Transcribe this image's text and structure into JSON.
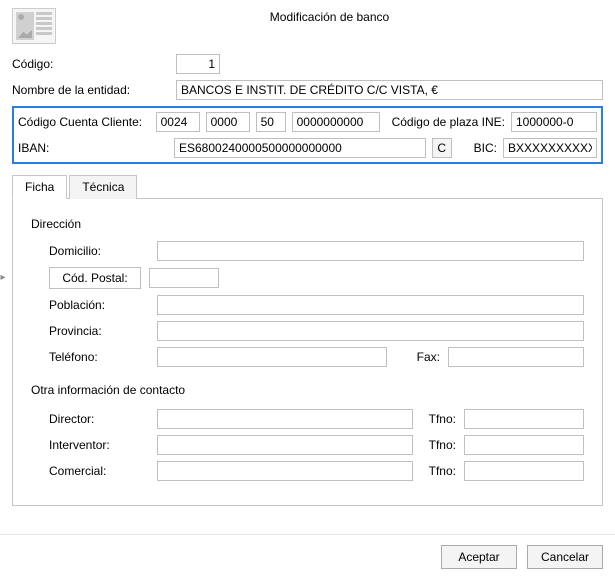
{
  "title": "Modificación de banco",
  "fields": {
    "codigo_label": "Código:",
    "codigo_value": "1",
    "entidad_label": "Nombre de la entidad:",
    "entidad_value": "BANCOS E INSTIT. DE CRÉDITO C/C VISTA, €",
    "ccc_label": "Código Cuenta Cliente:",
    "ccc_a": "0024",
    "ccc_b": "0000",
    "ccc_c": "50",
    "ccc_d": "0000000000",
    "ine_label": "Código de plaza INE:",
    "ine_value": "1000000-0",
    "iban_label": "IBAN:",
    "iban_value": "ES6800240000500000000000",
    "c_button": "C",
    "bic_label": "BIC:",
    "bic_value": "BXXXXXXXXXX"
  },
  "tabs": {
    "ficha": "Ficha",
    "tecnica": "Técnica"
  },
  "direccion": {
    "section": "Dirección",
    "domicilio_label": "Domicilio:",
    "domicilio_value": "",
    "cp_button": "Cód. Postal:",
    "cp_value": "",
    "poblacion_label": "Población:",
    "poblacion_value": "",
    "provincia_label": "Provincia:",
    "provincia_value": "",
    "telefono_label": "Teléfono:",
    "telefono_value": "",
    "fax_label": "Fax:",
    "fax_value": ""
  },
  "otra": {
    "section": "Otra información de contacto",
    "director_label": "Director:",
    "director_value": "",
    "interventor_label": "Interventor:",
    "interventor_value": "",
    "comercial_label": "Comercial:",
    "comercial_value": "",
    "tfno_label": "Tfno:",
    "tfno_director": "",
    "tfno_interventor": "",
    "tfno_comercial": ""
  },
  "buttons": {
    "accept": "Aceptar",
    "cancel": "Cancelar"
  },
  "chevron": "▸"
}
